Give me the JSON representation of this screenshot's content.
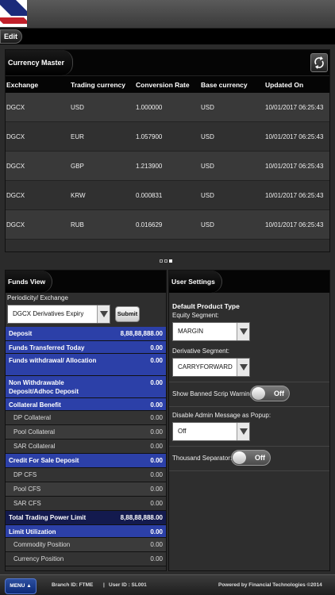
{
  "topbar": {
    "edit_label": "Edit"
  },
  "currency_master": {
    "title": "Currency Master",
    "columns": [
      "Exchange",
      "Trading currency",
      "Conversion Rate",
      "Base currency",
      "Updated On"
    ],
    "rows": [
      [
        "DGCX",
        "USD",
        "1.000000",
        "USD",
        "10/01/2017 06:25:43"
      ],
      [
        "DGCX",
        "EUR",
        "1.057900",
        "USD",
        "10/01/2017 06:25:43"
      ],
      [
        "DGCX",
        "GBP",
        "1.213900",
        "USD",
        "10/01/2017 06:25:43"
      ],
      [
        "DGCX",
        "KRW",
        "0.000831",
        "USD",
        "10/01/2017 06:25:43"
      ],
      [
        "DGCX",
        "RUB",
        "0.016629",
        "USD",
        "10/01/2017 06:25:43"
      ]
    ]
  },
  "funds_view": {
    "title": "Funds View",
    "periodicity_label": "Periodicity/ Exchange",
    "periodicity_value": "DGCX Derivatives Expiry",
    "submit_label": "Submit",
    "rows": [
      {
        "label": "Deposit",
        "value": "8,88,88,888.00",
        "style": "blue"
      },
      {
        "label": "Funds Transferred Today",
        "value": "0.00",
        "style": "blue"
      },
      {
        "label": "Funds withdrawal/ Allocation",
        "value": "0.00",
        "style": "blue"
      },
      {
        "label": "Non Withdrawable Deposit/Adhoc Deposit",
        "value": "0.00",
        "style": "blue"
      },
      {
        "label": "Collateral Benefit",
        "value": "0.00",
        "style": "blue"
      },
      {
        "label": "DP Collateral",
        "value": "0.00",
        "style": "sub"
      },
      {
        "label": "Pool Collateral",
        "value": "0.00",
        "style": "sub"
      },
      {
        "label": "SAR Collateral",
        "value": "0.00",
        "style": "sub"
      },
      {
        "label": "Credit For Sale Deposit",
        "value": "0.00",
        "style": "blue"
      },
      {
        "label": "DP CFS",
        "value": "0.00",
        "style": "sub"
      },
      {
        "label": "Pool CFS",
        "value": "0.00",
        "style": "sub"
      },
      {
        "label": "SAR CFS",
        "value": "0.00",
        "style": "sub"
      },
      {
        "label": "Total Trading Power Limit",
        "value": "8,88,88,888.00",
        "style": "navy"
      },
      {
        "label": "Limit Utilization",
        "value": "0.00",
        "style": "blue"
      },
      {
        "label": "Commodity Position",
        "value": "0.00",
        "style": "sub"
      },
      {
        "label": "Currency Position",
        "value": "0.00",
        "style": "sub"
      }
    ]
  },
  "user_settings": {
    "title": "User Settings",
    "default_product_type": "Default Product Type",
    "equity_label": "Equity Segment:",
    "equity_value": "MARGIN",
    "derivative_label": "Derivative Segment:",
    "derivative_value": "CARRYFORWARD",
    "banned_label": "Show Banned Scrip Warning",
    "banned_toggle": "Off",
    "admin_label": "Disable Admin Message as Popup:",
    "admin_value": "Off",
    "thousand_label": "Thousand Separator:",
    "thousand_toggle": "Off"
  },
  "footer": {
    "menu_label": "MENU ▲",
    "branch": "Branch ID:  FTME",
    "separator": "|",
    "user": "User ID :  SL001",
    "powered": "Powered by Financial Technologies ©2014"
  }
}
